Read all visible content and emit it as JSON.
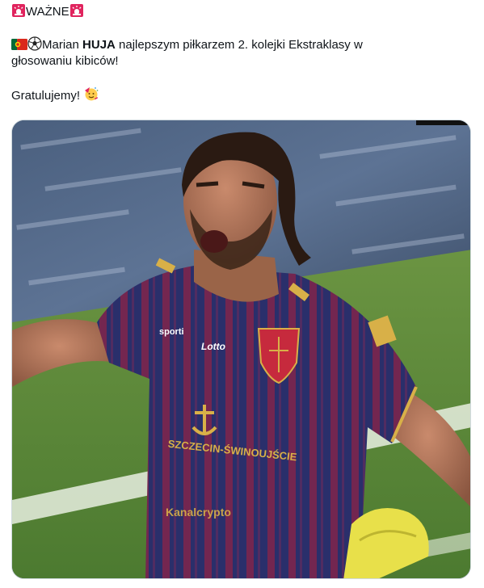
{
  "tweet": {
    "header_text": "WAŻNE",
    "line1_pre": "Marian ",
    "line1_bold": "HUJA",
    "line1_post": " najlepszym piłkarzem 2. kolejki Ekstraklasy w",
    "line2": "głosowaniu kibiców!",
    "line3": "Gratulujemy!",
    "icons": [
      "siren-icon",
      "portugal-flag-icon",
      "soccer-ball-icon",
      "partying-face-icon"
    ]
  },
  "media": {
    "kit_texts": {
      "sponsor_top": "sporti",
      "brand": "Lotto",
      "city": "SZCZECIN-ŚWINOUJŚCIE",
      "sponsor_bottom": "Kanalcrypto"
    },
    "colors": {
      "jersey_navy": "#2a2f6b",
      "jersey_stripe": "#8a2347",
      "pitch_green": "#5e8a3a",
      "crest_red": "#c62a3d",
      "glove_yellow": "#e8e04a"
    }
  }
}
